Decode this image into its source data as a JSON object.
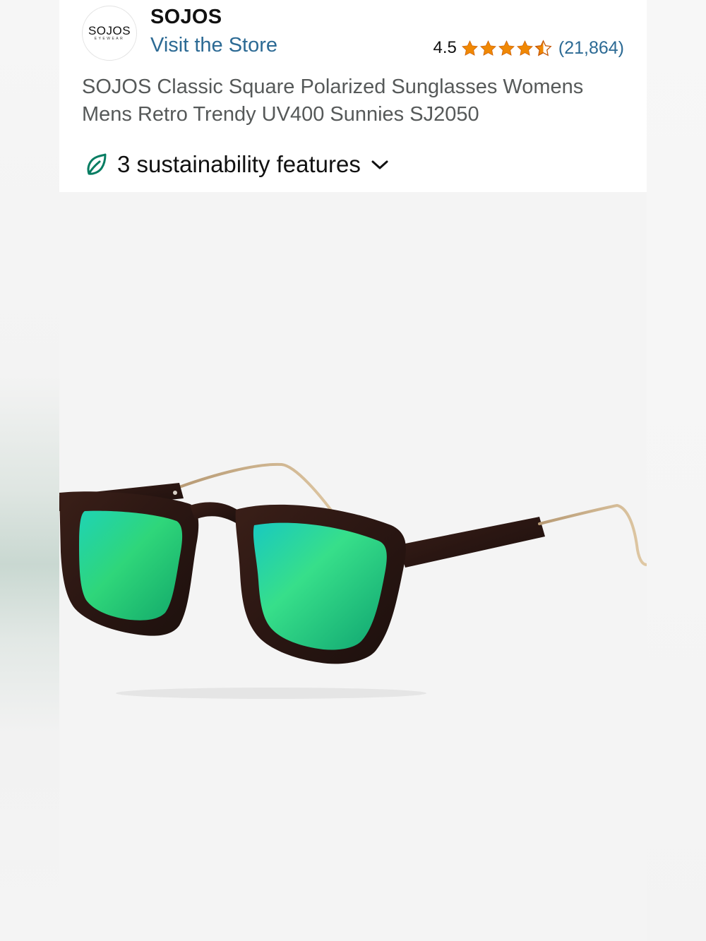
{
  "brand": {
    "logo_text": "SOJOS",
    "logo_subtext": "EYEWEAR",
    "name": "SOJOS",
    "store_link": "Visit the Store"
  },
  "rating": {
    "value": "4.5",
    "stars": 4.5,
    "review_count": "(21,864)",
    "star_color": "#f08804",
    "link_color": "#2c6a94"
  },
  "product": {
    "title": "SOJOS Classic Square Polarized Sunglasses Womens Mens Retro Trendy UV400 Sunnies SJ2050",
    "image_icon": "sunglasses-product-image"
  },
  "sustainability": {
    "label": "3 sustainability features",
    "icon": "leaf-icon",
    "expand_icon": "chevron-down-icon",
    "accent_color": "#067d62"
  }
}
